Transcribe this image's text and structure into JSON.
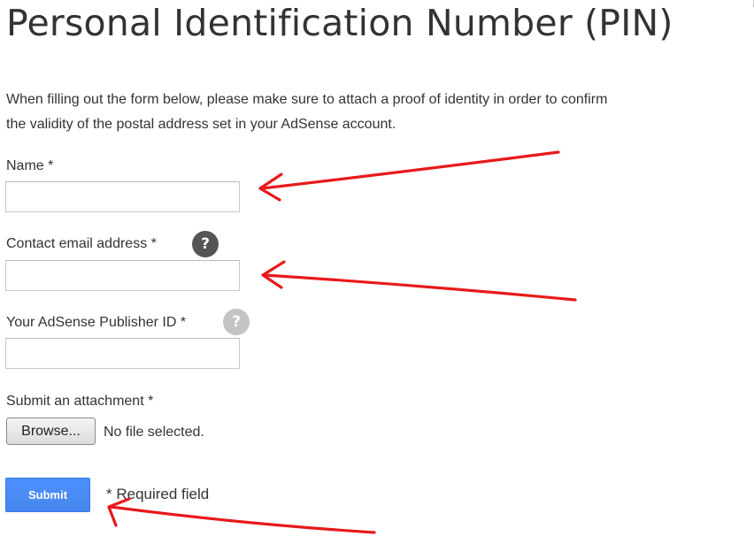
{
  "page": {
    "title": "Personal Identification Number (PIN)",
    "intro_line1": "When filling out the form below, please make sure to attach a proof of identity in order to confirm",
    "intro_line2": "the validity of the postal address set in your AdSense account."
  },
  "form": {
    "name": {
      "label": "Name *",
      "value": ""
    },
    "email": {
      "label": "Contact email address *",
      "value": "",
      "help_icon": "question-mark-icon",
      "help_glyph": "?"
    },
    "publisher_id": {
      "label": "Your AdSense Publisher ID *",
      "value": "",
      "help_icon": "question-mark-icon",
      "help_glyph": "?"
    },
    "attachment": {
      "label": "Submit an attachment *",
      "browse_label": "Browse...",
      "file_status": "No file selected."
    },
    "submit_label": "Submit",
    "required_note": "* Required field"
  },
  "annotations": {
    "arrow_color": "#e8191b",
    "arrows": [
      "arrow-to-name-field",
      "arrow-to-email-field",
      "arrow-to-submit-button"
    ]
  },
  "colors": {
    "text": "#333333",
    "input_border": "#c8c8c8",
    "help_icon_dark": "#555555",
    "help_icon_light": "#c4c4c4",
    "submit_blue": "#4d90fe"
  }
}
